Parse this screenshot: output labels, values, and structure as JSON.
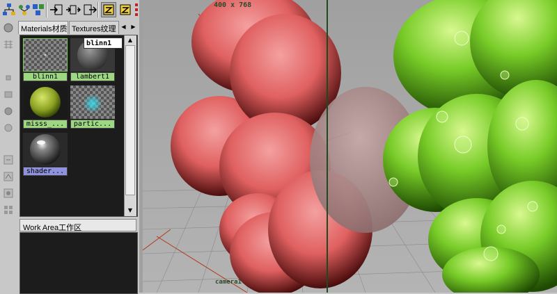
{
  "hypershade": {
    "tabs": [
      {
        "label": "Materials材质"
      },
      {
        "label": "Textures纹理"
      }
    ],
    "materials": [
      {
        "name": "blinn1",
        "label": "blinn1"
      },
      {
        "name": "lambert1",
        "label": "lambert1"
      },
      {
        "name": "misss",
        "label": "misss_..."
      },
      {
        "name": "partic",
        "label": "partic..."
      },
      {
        "name": "shader",
        "label": "shader..."
      }
    ],
    "tooltip": "blinn1",
    "work_area_label": "Work Area工作区"
  },
  "viewport": {
    "resolution": "400 x 768",
    "camera": "camera1"
  },
  "colors": {
    "selection_green": "#9ed782",
    "selection_blue": "#8f92dc",
    "sphere_red": "#e86a6a",
    "grape_green": "#7ad32a"
  }
}
